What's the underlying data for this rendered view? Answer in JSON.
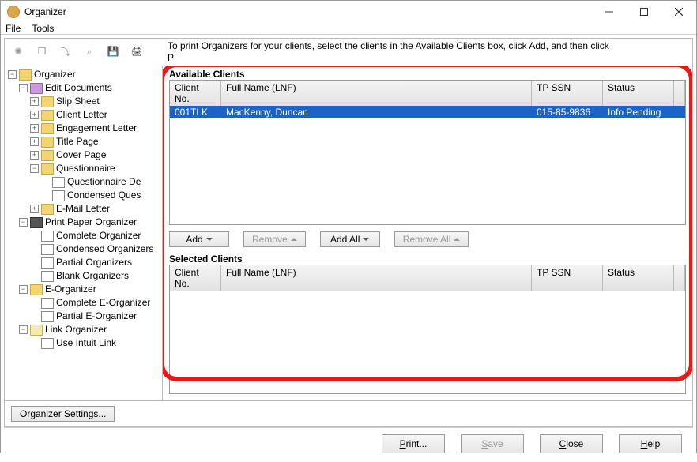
{
  "window": {
    "title": "Organizer"
  },
  "menubar": {
    "file": "File",
    "tools": "Tools"
  },
  "instruction": "To print Organizers for your clients, select the clients in the Available Clients box, click Add, and then click",
  "instruction2_prefix": "P",
  "tree": {
    "root": "Organizer",
    "edit_docs": "Edit Documents",
    "slip_sheet": "Slip Sheet",
    "client_letter": "Client Letter",
    "engagement_letter": "Engagement Letter",
    "title_page": "Title Page",
    "cover_page": "Cover Page",
    "questionnaire": "Questionnaire",
    "questionnaire_de": "Questionnaire De",
    "condensed_ques": "Condensed Ques",
    "email_letter": "E-Mail Letter",
    "print_paper": "Print Paper Organizer",
    "complete_org": "Complete Organizer",
    "condensed_org": "Condensed Organizers",
    "partial_org": "Partial Organizers",
    "blank_org": "Blank Organizers",
    "e_organizer": "E-Organizer",
    "complete_eorg": "Complete E-Organizer",
    "partial_eorg": "Partial E-Organizer",
    "link_org": "Link Organizer",
    "use_intuit": "Use Intuit Link"
  },
  "available": {
    "label": "Available Clients",
    "cols": {
      "cno": "Client No.",
      "name": "Full Name (LNF)",
      "ssn": "TP SSN",
      "status": "Status"
    },
    "rows": [
      {
        "cno": "001TLK",
        "name": "MacKenny, Duncan",
        "ssn": "015-85-9836",
        "status": "Info Pending"
      }
    ]
  },
  "midbtns": {
    "add": "Add",
    "remove": "Remove",
    "addall": "Add All",
    "removeall": "Remove All"
  },
  "selected": {
    "label": "Selected Clients",
    "cols": {
      "cno": "Client No.",
      "name": "Full Name (LNF)",
      "ssn": "TP SSN",
      "status": "Status"
    }
  },
  "settings_btn": "Organizer Settings...",
  "footer": {
    "print": "Print...",
    "save": "Save",
    "close": "Close",
    "help": "Help"
  }
}
